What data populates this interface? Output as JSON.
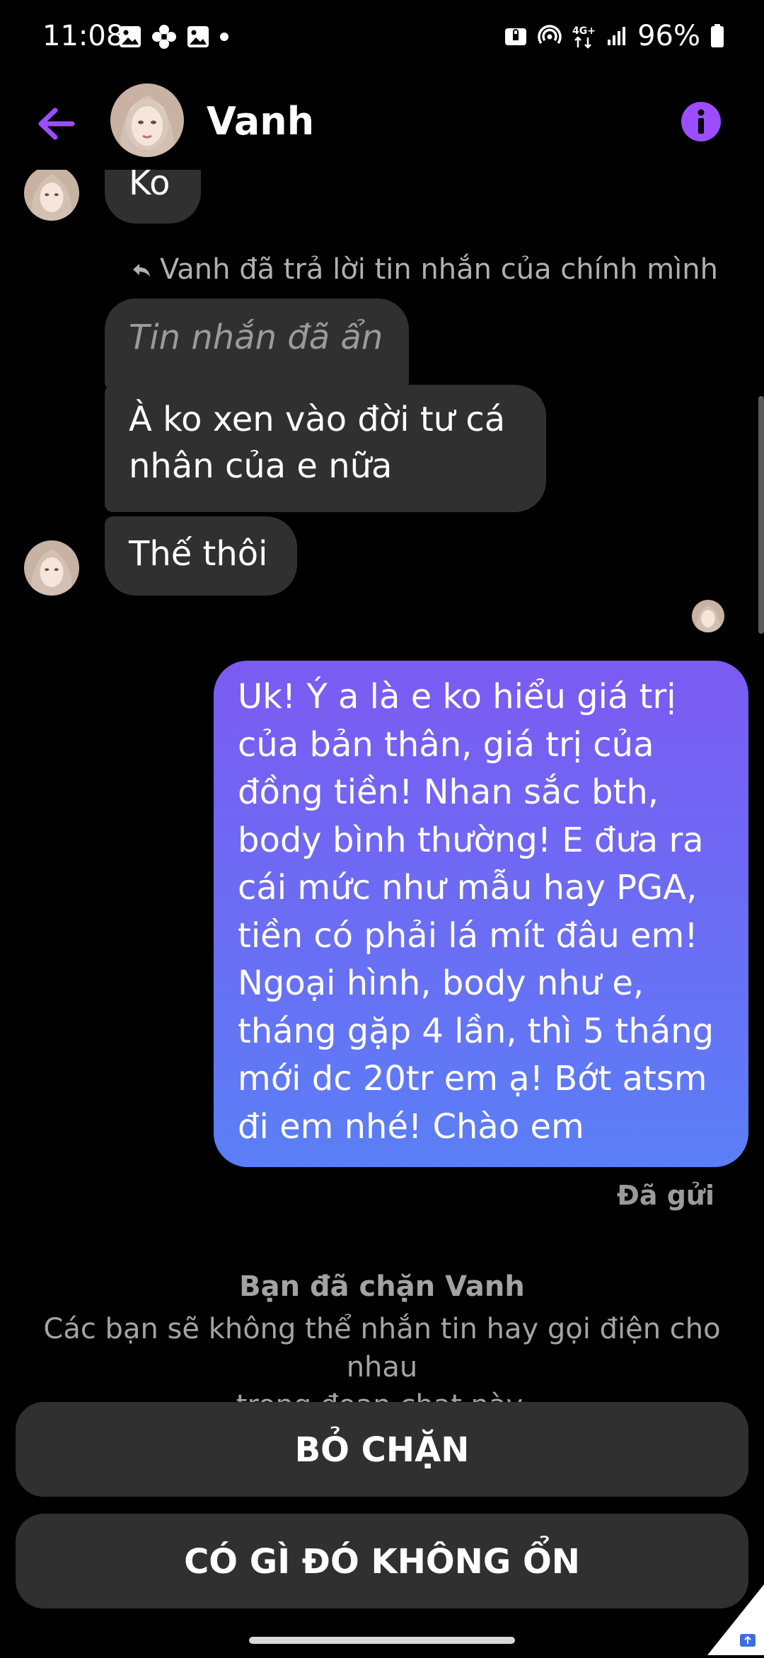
{
  "status_bar": {
    "time": "11:08",
    "left_icons": [
      "image-icon",
      "flower-icon",
      "image-icon",
      "dot-icon"
    ],
    "network": "4G+",
    "battery": "96%",
    "right_icons": [
      "lock-screen-icon",
      "hotspot-icon",
      "network-4g-icon",
      "signal-icon",
      "battery-icon"
    ]
  },
  "header": {
    "name": "Vanh",
    "back_icon": "back-arrow-icon",
    "info_icon": "info-icon",
    "accent": "#9b4dff"
  },
  "messages": {
    "ko": "Ko",
    "reply_note": "Vanh đã trả lời tin nhắn của chính mình",
    "hidden": "Tin nhắn đã ẩn",
    "a_ko_line1": "À ko xen vào đời tư cá",
    "a_ko_line2": "nhân của e nữa",
    "the_thoi": "Thế thôi",
    "sent_lines": [
      "Uk! Ý a là e ko hiểu giá trị",
      "của bản thân, giá trị của",
      "đồng tiền! Nhan sắc bth,",
      "body bình thường! E đưa ra",
      "cái mức như mẫu hay PGA,",
      "tiền có phải lá mít đâu em!",
      "Ngoại hình, body như e,",
      "tháng gặp 4 lần, thì 5 tháng",
      "mới dc 20tr em ạ! Bớt atsm",
      "đi em nhé! Chào em"
    ],
    "sent_status": "Đã gửi"
  },
  "blocked": {
    "title": "Bạn đã chặn Vanh",
    "desc_line1": "Các bạn sẽ không thể nhắn tin hay gọi điện cho nhau",
    "desc_line2": "trong đoạn chat này.",
    "unblock_label": "BỎ CHẶN",
    "report_label": "CÓ GÌ ĐÓ KHÔNG ỔN"
  },
  "colors": {
    "bubble_received": "#303030",
    "bubble_sent_top": "#7b5bf2",
    "bubble_sent_bottom": "#5a7ff6",
    "muted_text": "#a3a3a3"
  }
}
